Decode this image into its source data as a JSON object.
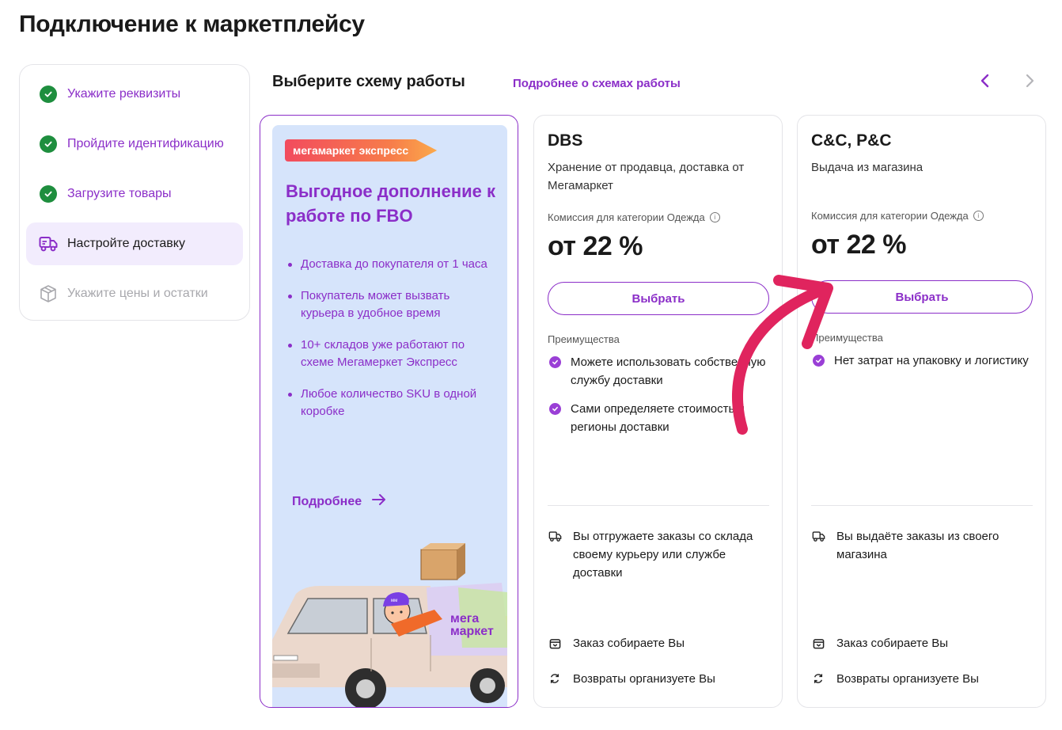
{
  "page": {
    "title": "Подключение к маркетплейсу"
  },
  "stepper": {
    "steps": [
      {
        "label": "Укажите реквизиты",
        "state": "done",
        "icon": "check-circle-icon"
      },
      {
        "label": "Пройдите идентификацию",
        "state": "done",
        "icon": "check-circle-icon"
      },
      {
        "label": "Загрузите товары",
        "state": "done",
        "icon": "check-circle-icon"
      },
      {
        "label": "Настройте доставку",
        "state": "active",
        "icon": "truck-icon"
      },
      {
        "label": "Укажите цены и остатки",
        "state": "disabled",
        "icon": "box-icon"
      }
    ]
  },
  "section": {
    "title": "Выберите схему работы",
    "link": "Подробнее о схемах работы",
    "prev_icon": "chevron-left-icon",
    "next_icon": "chevron-right-icon"
  },
  "promo": {
    "badge": "мегамаркет экспресс",
    "heading": "Выгодное дополнение к работе по FBO",
    "bullets": [
      "Доставка до покупателя от 1 часа",
      "Покупатель может вызвать курьера в удобное время",
      "10+ складов уже работают по схеме Мегамеркет Экспресс",
      "Любое количество SKU в одной коробке"
    ],
    "more": "Подробнее",
    "van_logo_line1": "мега",
    "van_logo_line2": "маркет",
    "cap_text": "мм"
  },
  "options": [
    {
      "name": "DBS",
      "description": "Хранение от продавца, доставка от Мегамаркет",
      "commission_label": "Комиссия для категории Одежда",
      "price": "от 22 %",
      "button": "Выбрать",
      "advantages_title": "Преимущества",
      "advantages": [
        "Можете использовать собственную службу доставки",
        "Сами определяете стоимость и регионы доставки"
      ],
      "features": [
        {
          "icon": "truck-icon",
          "text": "Вы отгружаете заказы со склада своему курьеру или службе доставки"
        },
        {
          "icon": "package-icon",
          "text": "Заказ собираете Вы"
        },
        {
          "icon": "refresh-icon",
          "text": "Возвраты организуете Вы"
        }
      ]
    },
    {
      "name": "C&C, P&C",
      "description": "Выдача из магазина",
      "commission_label": "Комиссия для категории Одежда",
      "price": "от 22 %",
      "button": "Выбрать",
      "advantages_title": "Преимущества",
      "advantages": [
        "Нет затрат на упаковку и логистику"
      ],
      "features": [
        {
          "icon": "truck-icon",
          "text": "Вы выдаёте заказы из своего магазина"
        },
        {
          "icon": "package-icon",
          "text": "Заказ собираете Вы"
        },
        {
          "icon": "refresh-icon",
          "text": "Возвраты организуете Вы"
        }
      ]
    }
  ],
  "colors": {
    "accent": "#8b2ec8",
    "done_green": "#1e8e3e",
    "annotation_arrow": "#e0245e",
    "promo_bg": "#d6e4fb"
  }
}
